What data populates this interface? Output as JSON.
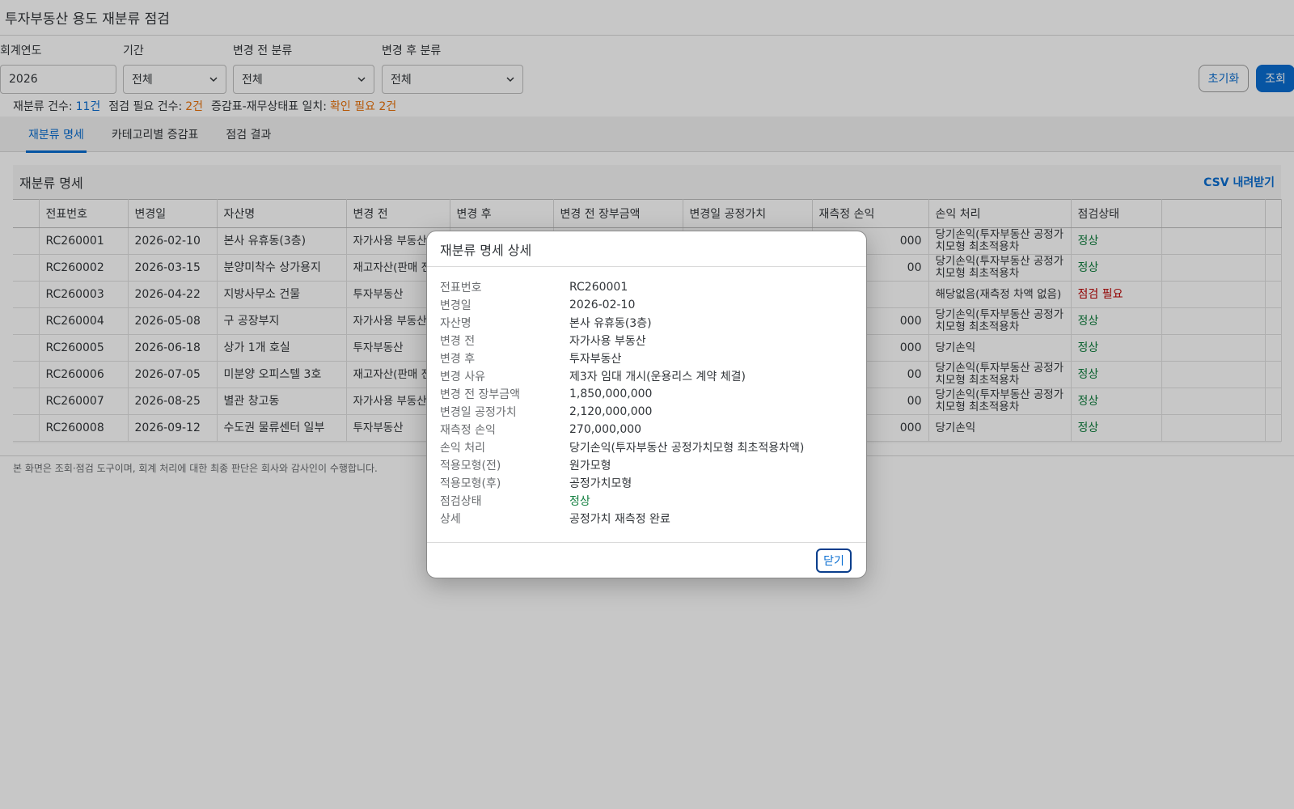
{
  "app": {
    "title": "투자부동산 용도 재분류 점검"
  },
  "filters": {
    "year": {
      "label": "회계연도",
      "value": "2026"
    },
    "period": {
      "label": "기간",
      "value": "전체"
    },
    "before": {
      "label": "변경 전 분류",
      "value": "전체"
    },
    "after": {
      "label": "변경 후 분류",
      "value": "전체"
    },
    "reset_label": "초기화",
    "search_label": "조회"
  },
  "summary": {
    "count_label": "재분류 건수:",
    "count_value": "11건",
    "check_label": "점검 필요 건수:",
    "check_value": "2건",
    "match_label": "증감표-재무상태표 일치:",
    "match_value": "확인 필요 2건"
  },
  "tabs": [
    {
      "label": "재분류 명세"
    },
    {
      "label": "카테고리별 증감표"
    },
    {
      "label": "점검 결과"
    }
  ],
  "panel": {
    "title": "재분류 명세",
    "csv_label": "CSV 내려받기"
  },
  "table": {
    "headers": [
      "전표번호",
      "변경일",
      "자산명",
      "변경 전",
      "변경 후",
      "변경 전 장부금액",
      "변경일 공정가치",
      "재측정 손익",
      "손익 처리",
      "점검상태"
    ],
    "rows": [
      {
        "no": "RC260001",
        "date": "2026-02-10",
        "asset": "본사 유휴동(3층)",
        "before": "자가사용 부동산",
        "after": "",
        "book": "",
        "fv": "",
        "remeasure": "000",
        "pl": "당기손익(투자부동산 공정가치모형 최초적용차",
        "status": "정상"
      },
      {
        "no": "RC260002",
        "date": "2026-03-15",
        "asset": "분양미착수 상가용지",
        "before": "재고자산(판매 전)",
        "after": "",
        "book": "",
        "fv": "",
        "remeasure": "00",
        "pl": "당기손익(투자부동산 공정가치모형 최초적용차",
        "status": "정상"
      },
      {
        "no": "RC260003",
        "date": "2026-04-22",
        "asset": "지방사무소 건물",
        "before": "투자부동산",
        "after": "",
        "book": "",
        "fv": "",
        "remeasure": "",
        "pl": "해당없음(재측정 차액 없음)",
        "status": "점검 필요"
      },
      {
        "no": "RC260004",
        "date": "2026-05-08",
        "asset": "구 공장부지",
        "before": "자가사용 부동산",
        "after": "",
        "book": "",
        "fv": "",
        "remeasure": "000",
        "pl": "당기손익(투자부동산 공정가치모형 최초적용차",
        "status": "정상"
      },
      {
        "no": "RC260005",
        "date": "2026-06-18",
        "asset": "상가 1개 호실",
        "before": "투자부동산",
        "after": "",
        "book": "",
        "fv": "",
        "remeasure": "000",
        "pl": "당기손익",
        "status": "정상"
      },
      {
        "no": "RC260006",
        "date": "2026-07-05",
        "asset": "미분양 오피스텔 3호",
        "before": "재고자산(판매 전)",
        "after": "",
        "book": "",
        "fv": "",
        "remeasure": "00",
        "pl": "당기손익(투자부동산 공정가치모형 최초적용차",
        "status": "정상"
      },
      {
        "no": "RC260007",
        "date": "2026-08-25",
        "asset": "별관 창고동",
        "before": "자가사용 부동산",
        "after": "",
        "book": "",
        "fv": "",
        "remeasure": "00",
        "pl": "당기손익(투자부동산 공정가치모형 최초적용차",
        "status": "정상"
      },
      {
        "no": "RC260008",
        "date": "2026-09-12",
        "asset": "수도권 물류센터 일부",
        "before": "투자부동산",
        "after": "",
        "book": "",
        "fv": "",
        "remeasure": "000",
        "pl": "당기손익",
        "status": "정상"
      }
    ]
  },
  "footnote": "본 화면은 조회·점검 도구이며, 회계 처리에 대한 최종 판단은 회사와 감사인이 수행합니다.",
  "dialog": {
    "title": "재분류 명세 상세",
    "rows": [
      {
        "k": "전표번호",
        "v": "RC260001"
      },
      {
        "k": "변경일",
        "v": "2026-02-10"
      },
      {
        "k": "자산명",
        "v": "본사 유휴동(3층)"
      },
      {
        "k": "변경 전",
        "v": "자가사용 부동산"
      },
      {
        "k": "변경 후",
        "v": "투자부동산"
      },
      {
        "k": "변경 사유",
        "v": "제3자 임대 개시(운용리스 계약 체결)"
      },
      {
        "k": "변경 전 장부금액",
        "v": "1,850,000,000"
      },
      {
        "k": "변경일 공정가치",
        "v": "2,120,000,000"
      },
      {
        "k": "재측정 손익",
        "v": "270,000,000"
      },
      {
        "k": "손익 처리",
        "v": "당기손익(투자부동산 공정가치모형 최초적용차액)"
      },
      {
        "k": "적용모형(전)",
        "v": "원가모형"
      },
      {
        "k": "적용모형(후)",
        "v": "공정가치모형"
      },
      {
        "k": "점검상태",
        "v": "정상"
      },
      {
        "k": "상세",
        "v": "공정가치 재측정 완료"
      }
    ],
    "close_label": "닫기"
  },
  "colors": {
    "accent": "#0a6ed1",
    "ok": "#107e3e",
    "warn": "#bb0000",
    "orange": "#e9730c"
  }
}
